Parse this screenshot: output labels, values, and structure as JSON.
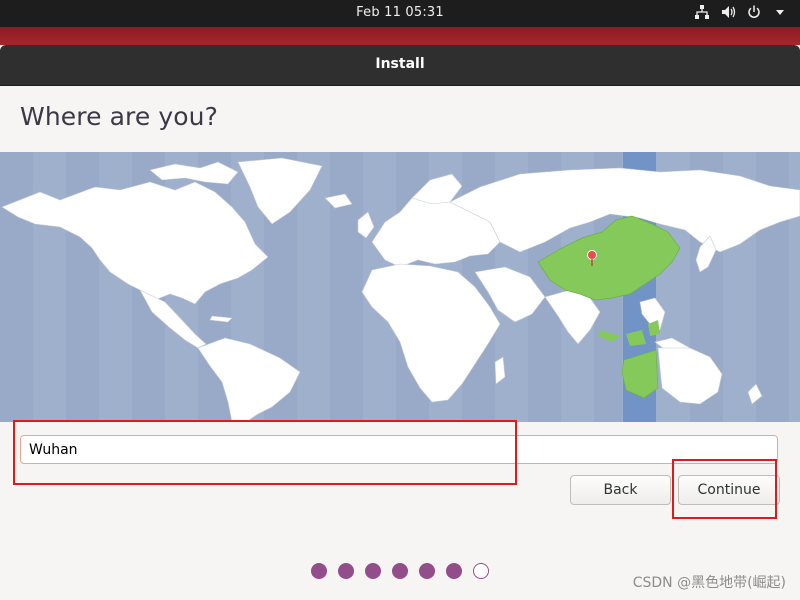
{
  "topbar": {
    "datetime": "Feb 11  05:31",
    "icons": [
      "network-wired-icon",
      "volume-icon",
      "power-icon",
      "caret-down-icon"
    ]
  },
  "window": {
    "title": "Install"
  },
  "page": {
    "heading": "Where are you?"
  },
  "map": {
    "selected_region": "Asia/Shanghai",
    "colors": {
      "ocean": "#9fb0cd",
      "land": "#ffffff",
      "highlight_zone": "#7193c6",
      "selected_land": "#85c95b",
      "pin": "#ef4a4a"
    }
  },
  "location_input": {
    "value": "Wuhan"
  },
  "buttons": {
    "back_label": "Back",
    "continue_label": "Continue"
  },
  "progress": {
    "total_steps": 7,
    "current_step": 7
  },
  "watermark": "CSDN @黑色地带(崛起)"
}
